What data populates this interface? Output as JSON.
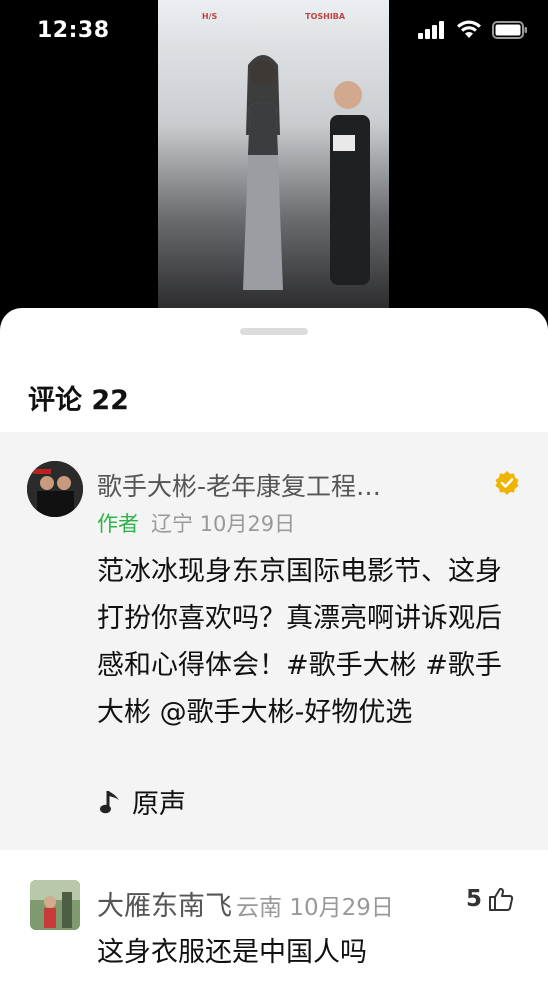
{
  "status_bar": {
    "time": "12:38"
  },
  "video": {
    "backdrop_logos": [
      "H/S",
      "TOSHIBA"
    ]
  },
  "comments": {
    "title": "评论 22",
    "author_comment": {
      "name": "歌手大彬-老年康复工程…",
      "author_tag": "作者",
      "location": "辽宁",
      "date": "10月29日",
      "text": "范冰冰现身东京国际电影节、这身打扮你喜欢吗？真漂亮啊讲诉观后感和心得体会！#歌手大彬 #歌手大彬 @歌手大彬-好物优选",
      "audio_label": "原声"
    },
    "reply": {
      "name": "大雁东南飞",
      "location": "云南",
      "date": "10月29日",
      "likes": "5",
      "text": "这身衣服还是中国人吗"
    }
  },
  "colors": {
    "author_tag": "#2fb34b",
    "verified_badge": "#f0b400"
  }
}
